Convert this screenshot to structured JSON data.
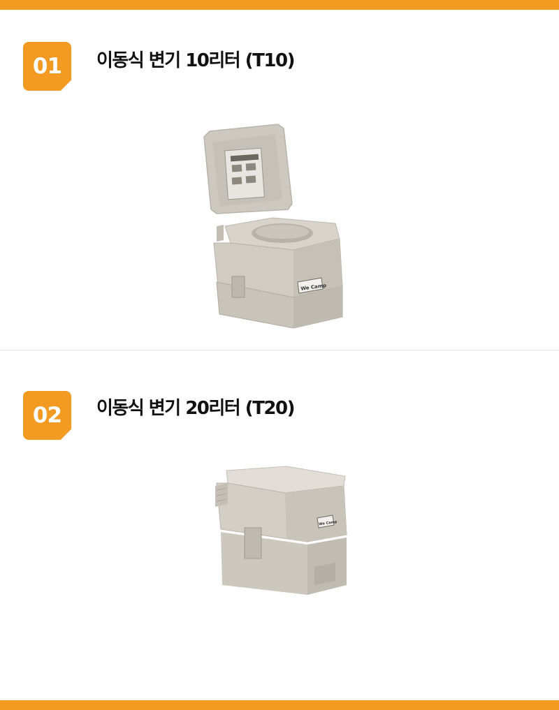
{
  "items": [
    {
      "number": "01",
      "title": "이동식 변기 10리터 (T10)",
      "label_text": "We Camp"
    },
    {
      "number": "02",
      "title": "이동식 변기 20리터 (T20)",
      "label_text": "We Camp"
    }
  ],
  "colors": {
    "accent": "#f29a22",
    "title_text": "#111111",
    "product_body": "#cfcbc3"
  }
}
